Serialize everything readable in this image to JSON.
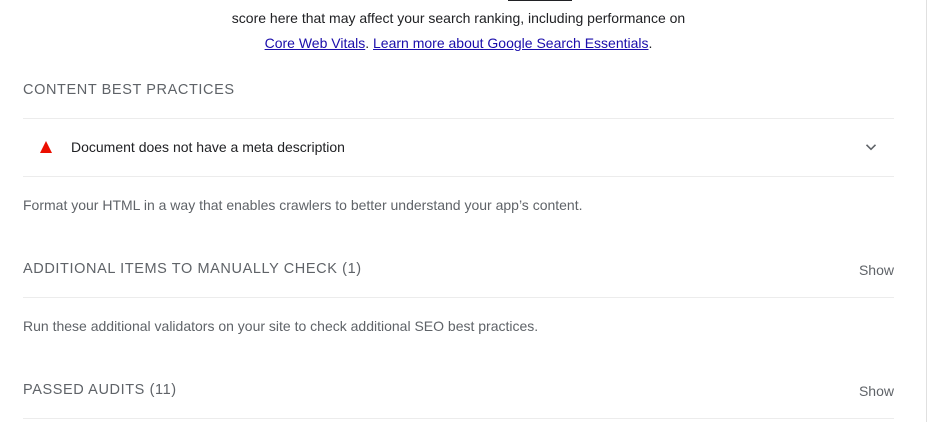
{
  "intro": {
    "line1": "score here that may affect your search ranking, including performance on",
    "link1": "Core Web Vitals",
    "sep": ". ",
    "link2": "Learn more about Google Search Essentials",
    "tail": "."
  },
  "content_best_practices": {
    "title": "CONTENT BEST PRACTICES",
    "audits": [
      {
        "title": "Document does not have a meta description",
        "status": "fail",
        "icon": "warning-triangle-icon"
      }
    ],
    "description": "Format your HTML in a way that enables crawlers to better understand your app’s content."
  },
  "manual_check": {
    "title": "ADDITIONAL ITEMS TO MANUALLY CHECK",
    "count": "(1)",
    "show_label": "Show",
    "description": "Run these additional validators on your site to check additional SEO best practices."
  },
  "passed_audits": {
    "title": "PASSED AUDITS",
    "count": "(11)",
    "show_label": "Show"
  },
  "colors": {
    "fail": "#eb0f00",
    "link": "#1a0dab",
    "muted": "#5f6368"
  }
}
